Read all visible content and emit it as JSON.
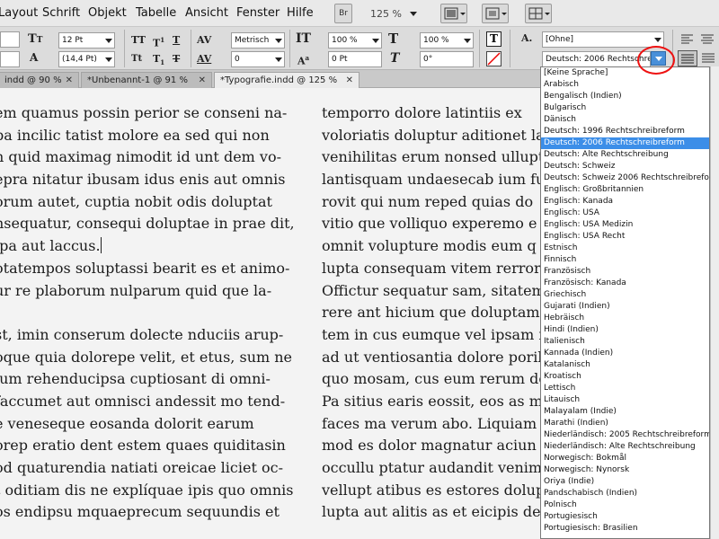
{
  "menubar": {
    "items": [
      "Layout",
      "Schrift",
      "Objekt",
      "Tabelle",
      "Ansicht",
      "Fenster",
      "Hilfe"
    ],
    "bridge_label": "Br",
    "zoom": "125 %"
  },
  "control_panel": {
    "font_size": "12 Pt",
    "leading": "(14,4 Pt)",
    "kerning": "Metrisch",
    "tracking": "0",
    "vertical_scale": "100 %",
    "baseline_shift": "0 Pt",
    "horizontal_scale": "100 %",
    "skew": "0°",
    "char_style": "[Ohne]",
    "language": "Deutsch: 2006 Rechtschreibreform"
  },
  "tabs": [
    {
      "label": "indd @ 90 %"
    },
    {
      "label": "*Unbenannt-1 @ 91 %"
    },
    {
      "label": "*Typografie.indd @ 125 %"
    }
  ],
  "left_column": [
    "em quamus possin perior se conseni na-",
    "pa incilic tatist molore ea sed qui non",
    "n quid maximag nimodit id unt dem vo-",
    "epra nitatur ibusam idus enis aut omnis",
    "orum autet, cuptia nobit odis doluptat",
    "nsequatur, consequi doluptae in prae dit,",
    "lpa aut laccus.",
    "otatempos soluptassi bearit es et animo-",
    "ur re plaborum nulparum quid que la-",
    "",
    "st, imin conserum dolecte nduciis arup-",
    "oque quia dolorepe velit, et etus, sum ne",
    "lum rehenducipsa cuptiosant di omni-",
    "faccumet aut omnisci andessit mo tend-",
    "e veneseque eosanda dolorit earum",
    "orep eratio dent estem quaes quiditasin",
    "od quaturendia natiati oreicae liciet oc-",
    "t oditiam dis ne explíquae ipis quo omnis",
    "os endipsu mquaeprecum sequundis et"
  ],
  "right_column": [
    "temporro dolore latintiis ex",
    "voloriatis doluptur aditionet la",
    "venihilitas erum nonsed ullupt",
    "lantisquam undaesecab ium fu",
    "rovit qui num reped quias do",
    "vitio que volliquo experemo e",
    "omnit volupture modis eum q",
    "lupta consequam vitem rerrore",
    "Offictur sequatur sam, sitatem",
    "rere ant hicium que doluptam",
    "tem in cus eumque vel ipsam i",
    "ad ut ventiosantia dolore poril",
    "quo mosam, cus eum rerum do",
    "Pa sitius earis eossit, eos as m",
    "faces ma verum abo. Liquiam",
    "mod es dolor magnatur aciun",
    "occullu ptatur audandit venim",
    "vellupt atibus es estores dolup",
    "lupta aut alitis as et eicipis de"
  ],
  "language_list": {
    "selected": "Deutsch: 2006 Rechtschreibreform",
    "items": [
      "[Keine Sprache]",
      "Arabisch",
      "Bengalisch (Indien)",
      "Bulgarisch",
      "Dänisch",
      "Deutsch: 1996 Rechtschreibreform",
      "Deutsch: 2006 Rechtschreibreform",
      "Deutsch: Alte Rechtschreibung",
      "Deutsch: Schweiz",
      "Deutsch: Schweiz 2006 Rechtschreibreform",
      "Englisch: Großbritannien",
      "Englisch: Kanada",
      "Englisch: USA",
      "Englisch: USA Medizin",
      "Englisch: USA Recht",
      "Estnisch",
      "Finnisch",
      "Französisch",
      "Französisch: Kanada",
      "Griechisch",
      "Gujarati (Indien)",
      "Hebräisch",
      "Hindi (Indien)",
      "Italienisch",
      "Kannada (Indien)",
      "Katalanisch",
      "Kroatisch",
      "Lettisch",
      "Litauisch",
      "Malayalam (Indie)",
      "Marathi (Indien)",
      "Niederländisch: 2005 Rechtschreibreform",
      "Niederländisch: Alte Rechtschreibung",
      "Norwegisch: Bokmål",
      "Norwegisch: Nynorsk",
      "Oriya (Indie)",
      "Pandschabisch (Indien)",
      "Polnisch",
      "Portugiesisch",
      "Portugiesisch: Brasilien"
    ]
  },
  "colors": {
    "selection": "#3c8ee8",
    "highlight_circle": "#e11111"
  }
}
